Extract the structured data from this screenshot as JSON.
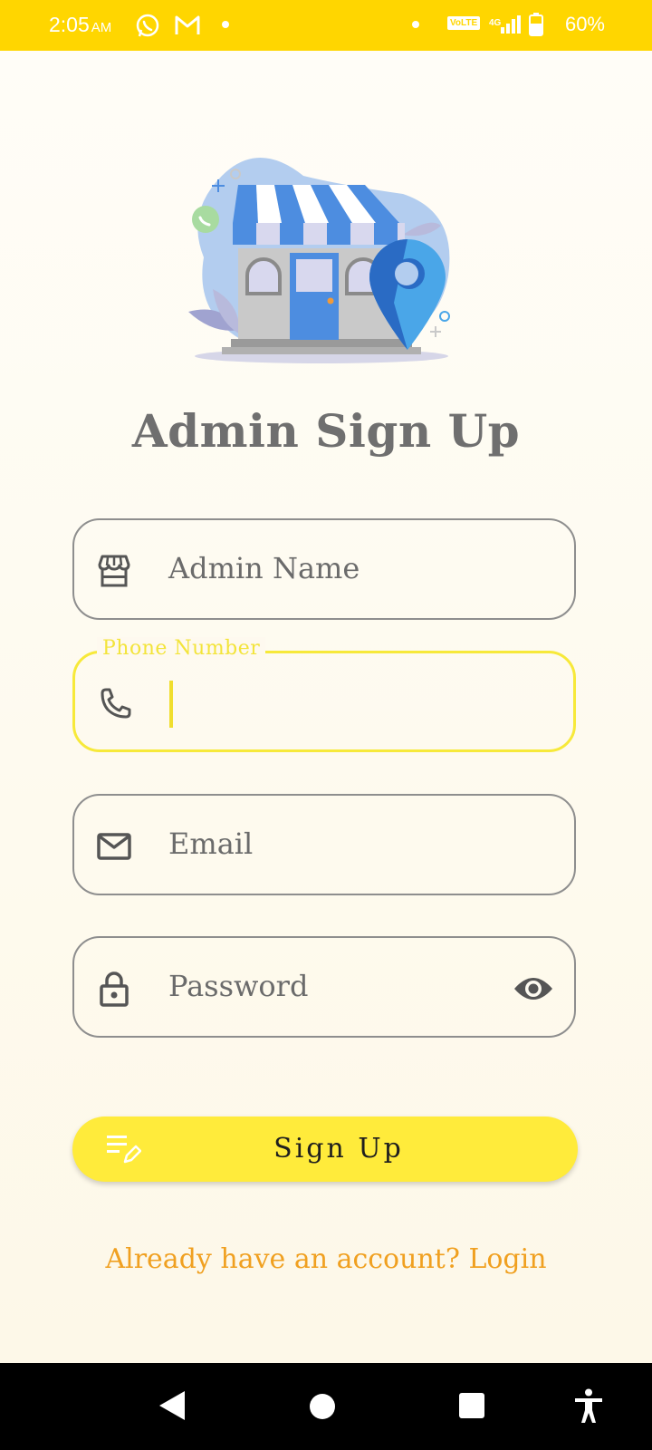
{
  "status_bar": {
    "time": "2:05",
    "ampm": "AM",
    "network_badge": "VoLTE",
    "network_type": "4G",
    "battery_percent": "60%",
    "icons": [
      "whatsapp-icon",
      "gmail-icon",
      "notification-dot-icon",
      "signal-icon",
      "battery-icon"
    ]
  },
  "page": {
    "title": "Admin Sign Up"
  },
  "form": {
    "admin_name": {
      "placeholder": "Admin Name",
      "value": "",
      "icon": "storefront-icon"
    },
    "phone_number": {
      "label": "Phone Number",
      "value": "",
      "icon": "phone-icon",
      "focused": true
    },
    "email": {
      "placeholder": "Email",
      "value": "",
      "icon": "mail-icon"
    },
    "password": {
      "placeholder": "Password",
      "value": "",
      "icon": "lock-icon",
      "toggle_icon": "eye-icon"
    }
  },
  "actions": {
    "signup_label": "Sign Up",
    "signup_icon": "edit-list-icon",
    "login_link": "Already have an account? Login"
  },
  "nav_bar": {
    "buttons": [
      "back-icon",
      "home-icon",
      "recents-icon",
      "accessibility-icon"
    ]
  },
  "colors": {
    "status_bar": "#ffd600",
    "accent": "#ffeb3b",
    "focus_border": "#f7e93a",
    "link": "#f0a020",
    "title": "#6f6f6f"
  }
}
